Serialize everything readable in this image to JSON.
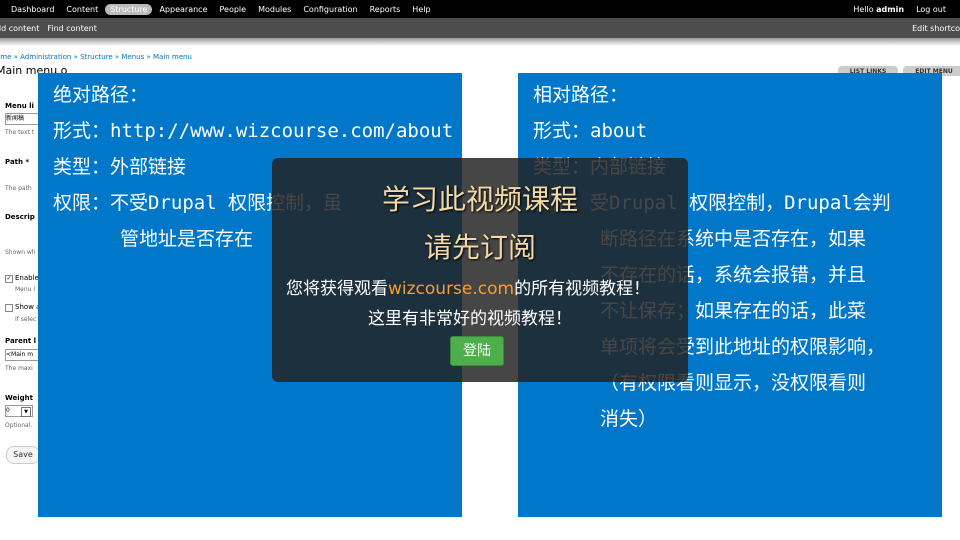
{
  "toolbar": {
    "items": [
      "Dashboard",
      "Content",
      "Structure",
      "Appearance",
      "People",
      "Modules",
      "Configuration",
      "Reports",
      "Help"
    ],
    "hello_prefix": "Hello",
    "user": "admin",
    "logout": "Log out"
  },
  "shortcuts": {
    "add_content": "dd content",
    "find_content": "Find content",
    "edit_shortcuts": "Edit shortco"
  },
  "breadcrumb": "ome » Administration » Structure » Menus » Main menu",
  "page_title": "Main menu  o",
  "tabs": [
    "LIST LINKS",
    "EDIT MENU"
  ],
  "form": {
    "menu_link_label": "Menu li",
    "menu_link_value": "新闻稿",
    "menu_link_desc": "The text t",
    "path_label": "Path *",
    "path_desc": "The path",
    "description_label": "Descrip",
    "shown_desc": "Shown wh",
    "enabled_label": "Enable",
    "enabled_desc": "Menu l",
    "show_expanded_label": "Show a",
    "show_expanded_desc": "If selec",
    "parent_label": "Parent l",
    "parent_value": "<Main m",
    "parent_desc": "The maxi",
    "weight_label": "Weight",
    "weight_value": "0",
    "weight_desc": "Optional.",
    "save_button": "Save"
  },
  "left_panel": {
    "line1": "绝对路径：",
    "line2": "形式：http://www.wizcourse.com/about",
    "line3": "类型：外部链接",
    "line4": "权限：不受Drupal 权限控制，虽",
    "line5": "管地址是否存在"
  },
  "right_panel": {
    "line1": "相对路径：",
    "line2": "形式：about",
    "line3": "类型：内部链接",
    "line4": "权限：受Drupal 权限控制，Drupal会判",
    "line5": "断路径在系统中是否存在，如果",
    "line6": "不存在的话，系统会报错，并且",
    "line7": "不让保存；如果存在的话，此菜",
    "line8": "单项将会受到此地址的权限影响，",
    "line9": "（有权限看则显示，没权限看则",
    "line10": "消失）"
  },
  "overlay": {
    "title1": "学习此视频课程",
    "title2": "请先订阅",
    "line1_prefix": "您将获得观看",
    "line1_site": "wizcourse.com",
    "line1_suffix": "的所有视频教程！",
    "line2": "这里有非常好的视频教程！",
    "login_button": "登陆"
  },
  "colors": {
    "panel_blue": "#0077c8",
    "overlay_title": "#f2d9a6",
    "site_link": "#ff9b2f",
    "login_green": "#4fae4c"
  }
}
